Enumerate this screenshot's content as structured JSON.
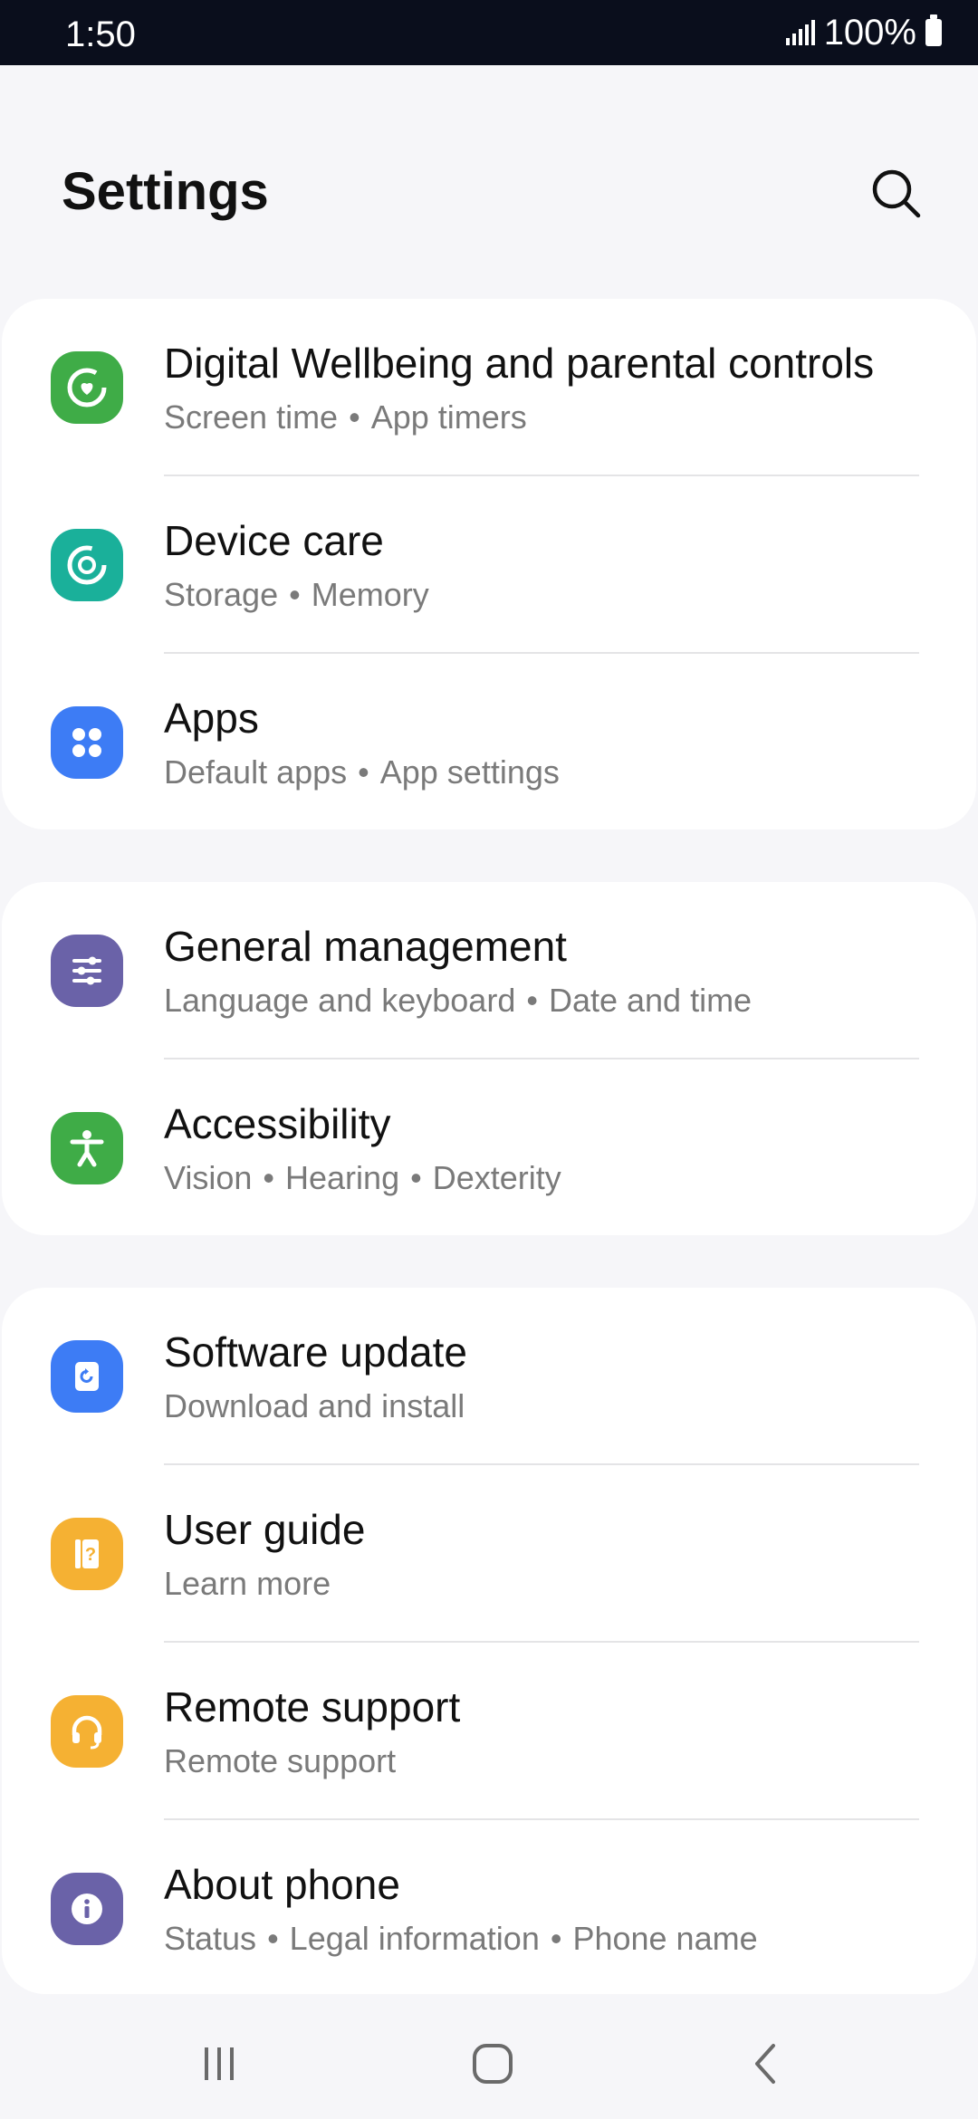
{
  "status_bar": {
    "time": "1:50",
    "battery": "100%"
  },
  "header": {
    "title": "Settings"
  },
  "groups": [
    {
      "items": [
        {
          "title": "Digital Wellbeing and parental controls",
          "subs": [
            "Screen time",
            "App timers"
          ],
          "icon": "digital-wellbeing-icon",
          "color": "#3fac47"
        },
        {
          "title": "Device care",
          "subs": [
            "Storage",
            "Memory"
          ],
          "icon": "device-care-icon",
          "color": "#1ab09a"
        },
        {
          "title": "Apps",
          "subs": [
            "Default apps",
            "App settings"
          ],
          "icon": "apps-icon",
          "color": "#3d7cf5"
        }
      ]
    },
    {
      "items": [
        {
          "title": "General management",
          "subs": [
            "Language and keyboard",
            "Date and time"
          ],
          "icon": "general-management-icon",
          "color": "#6a62a8"
        },
        {
          "title": "Accessibility",
          "subs": [
            "Vision",
            "Hearing",
            "Dexterity"
          ],
          "icon": "accessibility-icon",
          "color": "#3fac47"
        }
      ]
    },
    {
      "items": [
        {
          "title": "Software update",
          "subs": [
            "Download and install"
          ],
          "icon": "software-update-icon",
          "color": "#3d7cf5"
        },
        {
          "title": "User guide",
          "subs": [
            "Learn more"
          ],
          "icon": "user-guide-icon",
          "color": "#f5b133"
        },
        {
          "title": "Remote support",
          "subs": [
            "Remote support"
          ],
          "icon": "remote-support-icon",
          "color": "#f5b133"
        },
        {
          "title": "About phone",
          "subs": [
            "Status",
            "Legal information",
            "Phone name"
          ],
          "icon": "about-phone-icon",
          "color": "#6a62a8"
        }
      ]
    }
  ],
  "nav_bar": {
    "recents": "recents-icon",
    "home": "home-icon",
    "back": "back-icon"
  }
}
